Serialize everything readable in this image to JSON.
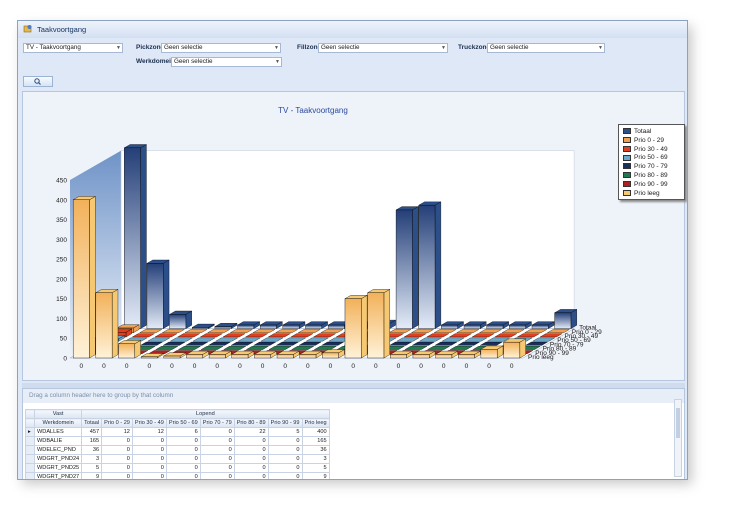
{
  "window": {
    "title": "Taakvoortgang"
  },
  "filters": {
    "report_select": "TV - Taakvoortgang",
    "pickzone_label": "Pickzone",
    "pickzone_value": "Geen selectie",
    "fillzone_label": "Fillzone",
    "fillzone_value": "Geen selectie",
    "truckzone_label": "Truckzone",
    "truckzone_value": "Geen selectie",
    "werkdomein_label": "Werkdomein",
    "werkdomein_value": "Geen selectie"
  },
  "chart_data": {
    "type": "bar",
    "title": "TV - Taakvoortgang",
    "yticks": [
      0,
      50,
      100,
      150,
      200,
      250,
      300,
      350,
      400,
      450
    ],
    "ylim": [
      0,
      450
    ],
    "xtick_labels": [
      "0",
      "0",
      "0",
      "0",
      "0",
      "0",
      "0",
      "0",
      "0",
      "0",
      "0",
      "0",
      "0",
      "0",
      "0",
      "0",
      "0",
      "0",
      "0",
      "0"
    ],
    "depth_labels": [
      "Totaal",
      "Prio 0 - 29",
      "Prio 30 - 49",
      "Prio 50 - 69",
      "Prio 70 - 79",
      "Prio 80 - 89",
      "Prio 90 - 99",
      "Prio leeg"
    ],
    "legend_position": "right",
    "series": [
      {
        "name": "Totaal",
        "color": "#2c4f8a",
        "values": [
          457,
          165,
          36,
          3,
          5,
          9,
          9,
          9,
          9,
          9,
          9,
          13,
          300,
          312,
          9,
          9,
          9,
          9,
          9,
          40
        ]
      },
      {
        "name": "Prio 0 - 29",
        "color": "#f0a050",
        "values": [
          12,
          0,
          0,
          0,
          0,
          0,
          0,
          0,
          0,
          0,
          0,
          0,
          0,
          0,
          0,
          0,
          0,
          0,
          0,
          0
        ]
      },
      {
        "name": "Prio 30 - 49",
        "color": "#e04020",
        "values": [
          12,
          0,
          0,
          0,
          0,
          0,
          0,
          0,
          0,
          0,
          0,
          0,
          0,
          0,
          0,
          0,
          0,
          0,
          0,
          0
        ]
      },
      {
        "name": "Prio 50 - 69",
        "color": "#6ea8c8",
        "values": [
          6,
          0,
          0,
          0,
          0,
          0,
          0,
          0,
          0,
          0,
          0,
          0,
          0,
          0,
          0,
          0,
          0,
          0,
          0,
          0
        ]
      },
      {
        "name": "Prio 70 - 79",
        "color": "#1a2e5a",
        "values": [
          0,
          0,
          0,
          0,
          0,
          0,
          0,
          0,
          0,
          0,
          0,
          0,
          0,
          0,
          0,
          0,
          0,
          0,
          0,
          0
        ]
      },
      {
        "name": "Prio 80 - 89",
        "color": "#1f7a50",
        "values": [
          22,
          0,
          0,
          0,
          0,
          0,
          0,
          0,
          0,
          0,
          0,
          0,
          0,
          0,
          0,
          0,
          0,
          0,
          0,
          0
        ]
      },
      {
        "name": "Prio 90 - 99",
        "color": "#b02020",
        "values": [
          5,
          0,
          0,
          0,
          0,
          0,
          0,
          0,
          0,
          0,
          0,
          0,
          0,
          0,
          0,
          0,
          0,
          0,
          0,
          0
        ]
      },
      {
        "name": "Prio leeg",
        "color": "#f6c872",
        "values": [
          400,
          165,
          36,
          3,
          5,
          9,
          9,
          9,
          9,
          9,
          9,
          13,
          150,
          165,
          9,
          9,
          9,
          9,
          22,
          40
        ]
      }
    ]
  },
  "grid": {
    "group_hint": "Drag a column header here to group by that column",
    "band_vast": "Vast",
    "band_lopend": "Lopend",
    "columns": [
      "Werkdomein",
      "Totaal",
      "Prio 0 - 29",
      "Prio 30 - 49",
      "Prio 50 - 69",
      "Prio 70 - 79",
      "Prio 80 - 89",
      "Prio 90 - 99",
      "Prio leeg"
    ],
    "rows": [
      [
        "WDALLES",
        "457",
        "12",
        "12",
        "6",
        "0",
        "22",
        "5",
        "400"
      ],
      [
        "WDBALIE",
        "165",
        "0",
        "0",
        "0",
        "0",
        "0",
        "0",
        "165"
      ],
      [
        "WDELEC_PND",
        "36",
        "0",
        "0",
        "0",
        "0",
        "0",
        "0",
        "36"
      ],
      [
        "WDGRT_PND24",
        "3",
        "0",
        "0",
        "0",
        "0",
        "0",
        "0",
        "3"
      ],
      [
        "WDGRT_PND25",
        "5",
        "0",
        "0",
        "0",
        "0",
        "0",
        "0",
        "5"
      ],
      [
        "WDGRT_PND27",
        "9",
        "0",
        "0",
        "0",
        "0",
        "0",
        "0",
        "9"
      ],
      [
        "WDGRT_PND29",
        "9",
        "0",
        "0",
        "0",
        "0",
        "0",
        "0",
        "9"
      ]
    ]
  }
}
